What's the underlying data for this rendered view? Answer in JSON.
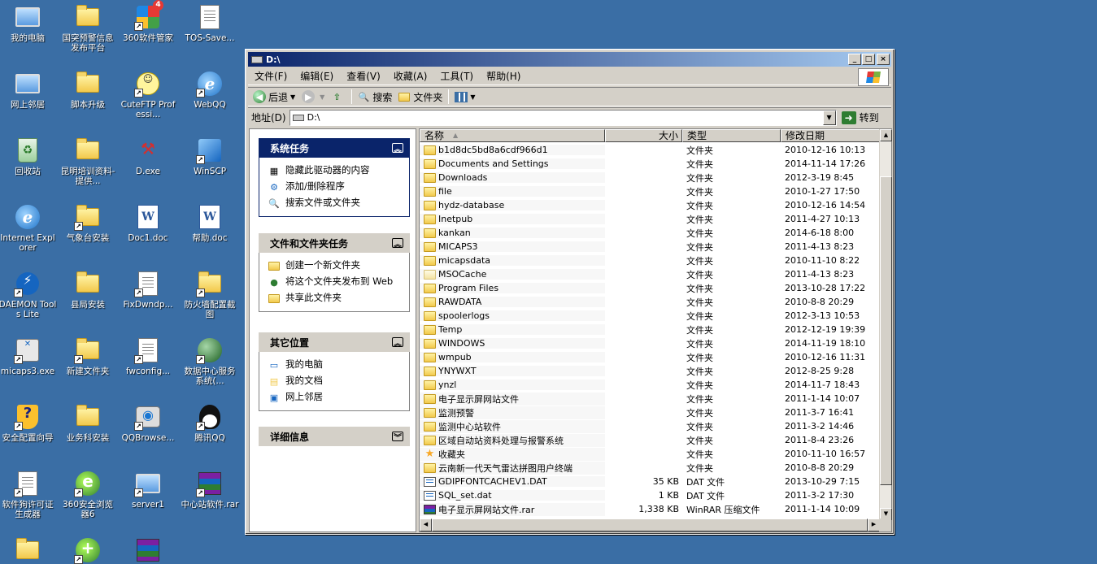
{
  "desktop": {
    "icons": [
      {
        "label": "我的电脑",
        "icon": "my-computer-icon"
      },
      {
        "label": "国突预警信息发布平台",
        "icon": "folder-icon"
      },
      {
        "label": "360软件管家",
        "icon": "360-software-manager-icon",
        "badge": "4"
      },
      {
        "label": "TOS-Save...",
        "icon": "document-icon"
      },
      {
        "label": "网上邻居",
        "icon": "network-places-icon"
      },
      {
        "label": "脚本升级",
        "icon": "folder-icon"
      },
      {
        "label": "CuteFTP Professi...",
        "icon": "cuteftp-icon"
      },
      {
        "label": "WebQQ",
        "icon": "internet-explorer-icon"
      },
      {
        "label": "回收站",
        "icon": "recycle-bin-icon"
      },
      {
        "label": "昆明培训资料-提供...",
        "icon": "folder-icon"
      },
      {
        "label": "D.exe",
        "icon": "tools-exe-icon"
      },
      {
        "label": "WinSCP",
        "icon": "winscp-icon"
      },
      {
        "label": "Internet Explorer",
        "icon": "internet-explorer-icon"
      },
      {
        "label": "气象台安装",
        "icon": "folder-icon"
      },
      {
        "label": "Doc1.doc",
        "icon": "word-document-icon"
      },
      {
        "label": "帮助.doc",
        "icon": "word-document-icon"
      },
      {
        "label": "DAEMON Tools Lite",
        "icon": "daemon-tools-icon"
      },
      {
        "label": "县局安装",
        "icon": "folder-icon"
      },
      {
        "label": "FixDwndp...",
        "icon": "document-icon"
      },
      {
        "label": "防火墙配置截图",
        "icon": "folder-icon"
      },
      {
        "label": "micaps3.exe",
        "icon": "micaps-icon"
      },
      {
        "label": "新建文件夹",
        "icon": "folder-icon"
      },
      {
        "label": "fwconfig...",
        "icon": "document-icon"
      },
      {
        "label": "数据中心服务系统(...",
        "icon": "globe-icon"
      },
      {
        "label": "安全配置向导",
        "icon": "security-wizard-icon"
      },
      {
        "label": "业务科安装",
        "icon": "folder-icon"
      },
      {
        "label": "QQBrowse...",
        "icon": "qq-browser-icon"
      },
      {
        "label": "腾讯QQ",
        "icon": "qq-icon"
      },
      {
        "label": "软件狗许可证生成器",
        "icon": "license-generator-icon"
      },
      {
        "label": "360安全浏览器6",
        "icon": "360-browser-icon"
      },
      {
        "label": "server1",
        "icon": "server-icon"
      },
      {
        "label": "中心站软件.rar",
        "icon": "winrar-archive-icon"
      },
      {
        "label": "",
        "icon": "folder-icon"
      },
      {
        "label": "",
        "icon": "360-add-icon"
      },
      {
        "label": "",
        "icon": "winrar-archive-icon"
      }
    ]
  },
  "window": {
    "title": "D:\\",
    "menu": [
      "文件(F)",
      "编辑(E)",
      "查看(V)",
      "收藏(A)",
      "工具(T)",
      "帮助(H)"
    ],
    "toolbar": {
      "back": "后退",
      "search": "搜索",
      "folders": "文件夹"
    },
    "address": {
      "label": "地址(D)",
      "value": "D:\\",
      "go": "转到"
    }
  },
  "taskpane": {
    "system_tasks": {
      "title": "系统任务",
      "items": [
        "隐藏此驱动器的内容",
        "添加/删除程序",
        "搜索文件或文件夹"
      ]
    },
    "file_tasks": {
      "title": "文件和文件夹任务",
      "items": [
        "创建一个新文件夹",
        "将这个文件夹发布到 Web",
        "共享此文件夹"
      ]
    },
    "other_places": {
      "title": "其它位置",
      "items": [
        "我的电脑",
        "我的文档",
        "网上邻居"
      ]
    },
    "details": {
      "title": "详细信息"
    }
  },
  "filelist": {
    "columns": {
      "name": "名称",
      "size": "大小",
      "type": "类型",
      "date": "修改日期"
    },
    "rows": [
      {
        "name": "b1d8dc5bd8a6cdf966d1",
        "size": "",
        "type": "文件夹",
        "date": "2010-12-16 10:13",
        "icon": "folder"
      },
      {
        "name": "Documents and Settings",
        "size": "",
        "type": "文件夹",
        "date": "2014-11-14 17:26",
        "icon": "folder"
      },
      {
        "name": "Downloads",
        "size": "",
        "type": "文件夹",
        "date": "2012-3-19 8:45",
        "icon": "folder"
      },
      {
        "name": "file",
        "size": "",
        "type": "文件夹",
        "date": "2010-1-27 17:50",
        "icon": "folder"
      },
      {
        "name": "hydz-database",
        "size": "",
        "type": "文件夹",
        "date": "2010-12-16 14:54",
        "icon": "folder"
      },
      {
        "name": "Inetpub",
        "size": "",
        "type": "文件夹",
        "date": "2011-4-27 10:13",
        "icon": "folder"
      },
      {
        "name": "kankan",
        "size": "",
        "type": "文件夹",
        "date": "2014-6-18 8:00",
        "icon": "folder"
      },
      {
        "name": "MICAPS3",
        "size": "",
        "type": "文件夹",
        "date": "2011-4-13 8:23",
        "icon": "folder"
      },
      {
        "name": "micapsdata",
        "size": "",
        "type": "文件夹",
        "date": "2010-11-10 8:22",
        "icon": "folder"
      },
      {
        "name": "MSOCache",
        "size": "",
        "type": "文件夹",
        "date": "2011-4-13 8:23",
        "icon": "folder-light"
      },
      {
        "name": "Program Files",
        "size": "",
        "type": "文件夹",
        "date": "2013-10-28 17:22",
        "icon": "folder"
      },
      {
        "name": "RAWDATA",
        "size": "",
        "type": "文件夹",
        "date": "2010-8-8 20:29",
        "icon": "folder"
      },
      {
        "name": "spoolerlogs",
        "size": "",
        "type": "文件夹",
        "date": "2012-3-13 10:53",
        "icon": "folder"
      },
      {
        "name": "Temp",
        "size": "",
        "type": "文件夹",
        "date": "2012-12-19 19:39",
        "icon": "folder"
      },
      {
        "name": "WINDOWS",
        "size": "",
        "type": "文件夹",
        "date": "2014-11-19 18:10",
        "icon": "folder"
      },
      {
        "name": "wmpub",
        "size": "",
        "type": "文件夹",
        "date": "2010-12-16 11:31",
        "icon": "folder"
      },
      {
        "name": "YNYWXT",
        "size": "",
        "type": "文件夹",
        "date": "2012-8-25 9:28",
        "icon": "folder"
      },
      {
        "name": "ynzl",
        "size": "",
        "type": "文件夹",
        "date": "2014-11-7 18:43",
        "icon": "folder"
      },
      {
        "name": "电子显示屏网站文件",
        "size": "",
        "type": "文件夹",
        "date": "2011-1-14 10:07",
        "icon": "folder"
      },
      {
        "name": "监测预警",
        "size": "",
        "type": "文件夹",
        "date": "2011-3-7 16:41",
        "icon": "folder"
      },
      {
        "name": "监测中心站软件",
        "size": "",
        "type": "文件夹",
        "date": "2011-3-2 14:46",
        "icon": "folder"
      },
      {
        "name": "区域自动站资料处理与报警系统",
        "size": "",
        "type": "文件夹",
        "date": "2011-8-4 23:26",
        "icon": "folder"
      },
      {
        "name": "收藏夹",
        "size": "",
        "type": "文件夹",
        "date": "2010-11-10 16:57",
        "icon": "star"
      },
      {
        "name": "云南新一代天气雷达拼图用户终端",
        "size": "",
        "type": "文件夹",
        "date": "2010-8-8 20:29",
        "icon": "folder"
      },
      {
        "name": "GDIPFONTCACHEV1.DAT",
        "size": "35 KB",
        "type": "DAT 文件",
        "date": "2013-10-29 7:15",
        "icon": "dat"
      },
      {
        "name": "SQL_set.dat",
        "size": "1 KB",
        "type": "DAT 文件",
        "date": "2011-3-2 17:30",
        "icon": "dat"
      },
      {
        "name": "电子显示屏网站文件.rar",
        "size": "1,338 KB",
        "type": "WinRAR 压缩文件",
        "date": "2011-1-14 10:09",
        "icon": "rar"
      }
    ]
  }
}
